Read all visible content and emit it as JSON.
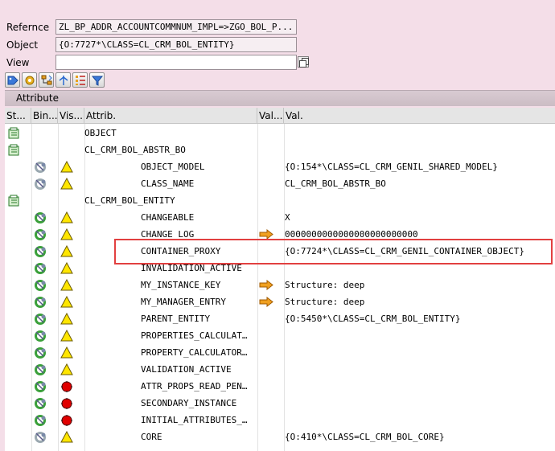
{
  "fields": {
    "reference_label": "Refernce",
    "reference_value": "ZL_BP_ADDR_ACCOUNTCOMMNUM_IMPL=>ZGO_BOL_P...",
    "object_label": "Object",
    "object_value": "{O:7727*\\CLASS=CL_CRM_BOL_ENTITY}",
    "view_label": "View",
    "view_value": ""
  },
  "toolbar_icons": [
    "tag-icon",
    "gear-bulb-icon",
    "hierarchy-icon",
    "split-icon",
    "list-tree-icon",
    "filter-icon"
  ],
  "panel": {
    "title": "Attribute"
  },
  "columns": [
    "St...",
    "Bin...",
    "Vis...",
    "Attrib.",
    "Val...",
    "Val."
  ],
  "rows": [
    {
      "status": "structure",
      "bind": "",
      "vis": "",
      "attr": "OBJECT",
      "indent": 0,
      "arrow": false,
      "value": ""
    },
    {
      "status": "structure",
      "bind": "",
      "vis": "",
      "attr": "CL_CRM_BOL_ABSTR_BO",
      "indent": 0,
      "arrow": false,
      "value": ""
    },
    {
      "status": "",
      "bind": "ring-gray",
      "vis": "warning",
      "attr": "OBJECT_MODEL",
      "indent": 1,
      "arrow": false,
      "value": "{O:154*\\CLASS=CL_CRM_GENIL_SHARED_MODEL}"
    },
    {
      "status": "",
      "bind": "ring-gray",
      "vis": "warning",
      "attr": "CLASS_NAME",
      "indent": 1,
      "arrow": false,
      "value": "CL_CRM_BOL_ABSTR_BO"
    },
    {
      "status": "structure",
      "bind": "",
      "vis": "",
      "attr": "CL_CRM_BOL_ENTITY",
      "indent": 0,
      "arrow": false,
      "value": ""
    },
    {
      "status": "",
      "bind": "ring-green",
      "vis": "warning",
      "attr": "CHANGEABLE",
      "indent": 1,
      "arrow": false,
      "value": "X"
    },
    {
      "status": "",
      "bind": "ring-green",
      "vis": "warning",
      "attr": "CHANGE_LOG",
      "indent": 1,
      "arrow": true,
      "value": "0000000000000000000000000"
    },
    {
      "status": "",
      "bind": "ring-green",
      "vis": "warning",
      "attr": "CONTAINER_PROXY",
      "indent": 1,
      "arrow": false,
      "value": "{O:7724*\\CLASS=CL_CRM_GENIL_CONTAINER_OBJECT}"
    },
    {
      "status": "",
      "bind": "ring-green",
      "vis": "warning",
      "attr": "INVALIDATION_ACTIVE",
      "indent": 1,
      "arrow": false,
      "value": ""
    },
    {
      "status": "",
      "bind": "ring-green",
      "vis": "warning",
      "attr": "MY_INSTANCE_KEY",
      "indent": 1,
      "arrow": true,
      "value": "Structure: deep"
    },
    {
      "status": "",
      "bind": "ring-green",
      "vis": "warning",
      "attr": "MY_MANAGER_ENTRY",
      "indent": 1,
      "arrow": true,
      "value": "Structure: deep"
    },
    {
      "status": "",
      "bind": "ring-green",
      "vis": "warning",
      "attr": "PARENT_ENTITY",
      "indent": 1,
      "arrow": false,
      "value": "{O:5450*\\CLASS=CL_CRM_BOL_ENTITY}"
    },
    {
      "status": "",
      "bind": "ring-green",
      "vis": "warning",
      "attr": "PROPERTIES_CALCULAT…",
      "indent": 1,
      "arrow": false,
      "value": ""
    },
    {
      "status": "",
      "bind": "ring-green",
      "vis": "warning",
      "attr": "PROPERTY_CALCULATOR…",
      "indent": 1,
      "arrow": false,
      "value": ""
    },
    {
      "status": "",
      "bind": "ring-green",
      "vis": "warning",
      "attr": "VALIDATION_ACTIVE",
      "indent": 1,
      "arrow": false,
      "value": ""
    },
    {
      "status": "",
      "bind": "ring-green",
      "vis": "stop",
      "attr": "ATTR_PROPS_READ_PEN…",
      "indent": 1,
      "arrow": false,
      "value": ""
    },
    {
      "status": "",
      "bind": "ring-green",
      "vis": "stop",
      "attr": "SECONDARY_INSTANCE",
      "indent": 1,
      "arrow": false,
      "value": ""
    },
    {
      "status": "",
      "bind": "ring-green",
      "vis": "stop",
      "attr": "INITIAL_ATTRIBUTES_…",
      "indent": 1,
      "arrow": false,
      "value": ""
    },
    {
      "status": "",
      "bind": "ring-gray",
      "vis": "warning",
      "attr": "CORE",
      "indent": 1,
      "arrow": false,
      "value": "{O:410*\\CLASS=CL_CRM_BOL_CORE}"
    }
  ],
  "colors": {
    "highlight": "#e24040",
    "arrow": "#f0a020",
    "warning": "#ffe600",
    "stop": "#e00000"
  }
}
